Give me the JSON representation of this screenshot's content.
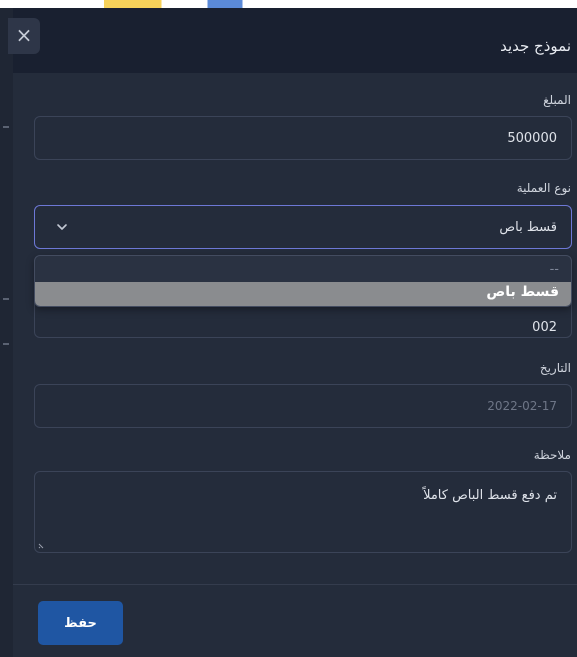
{
  "modal": {
    "title": "نموذج جديد",
    "close_glyph": "×"
  },
  "form": {
    "amount": {
      "label": "المبلغ",
      "value": "500000"
    },
    "operation_type": {
      "label": "نوع العملية",
      "selected": "قسط باص",
      "options": [
        "--",
        "قسط باص"
      ]
    },
    "hidden_field": {
      "value": "002"
    },
    "date": {
      "label": "التاريخ",
      "value": "2022-02-17"
    },
    "note": {
      "label": "ملاحظة",
      "value": "تم دفع قسط الباص كاملاً"
    }
  },
  "footer": {
    "save_label": "حفظ"
  },
  "colors": {
    "modal_bg": "#242c3b",
    "header_bg": "#192030",
    "accent": "#1f56a3",
    "select_focus": "#6d78d6",
    "option_highlight": "#8a8c8f"
  },
  "icons": {
    "close": "close-icon",
    "chevron": "chevron-down-icon",
    "resize": "resize-handle-icon"
  }
}
